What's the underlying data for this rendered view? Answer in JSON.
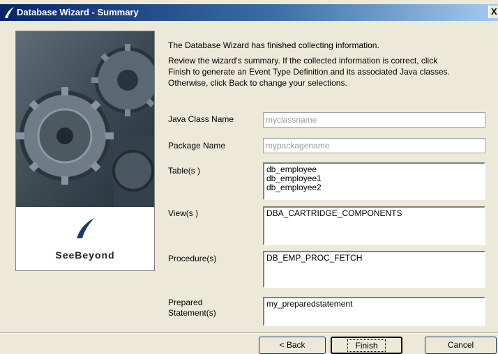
{
  "window": {
    "title": "Database Wizard - Summary",
    "close_glyph": "X"
  },
  "side_panel": {
    "brand_name": "SeeBeyond",
    "art_icon": "gears-image",
    "logo_icon": "seebeyond-swoosh-icon"
  },
  "intro": {
    "line1": "The Database Wizard has finished collecting information.",
    "line2": "Review the wizard's summary.  If the collected information is correct, click Finish to generate an Event Type Definition and its associated Java classes.  Otherwise, click Back to change your selections."
  },
  "fields": {
    "java_class": {
      "label": "Java Class Name",
      "value": "myclassname"
    },
    "package": {
      "label": "Package Name",
      "value": "mypackagename"
    },
    "tables": {
      "label": "Table(s )",
      "items": [
        "db_employee",
        "db_employee1",
        "db_employee2"
      ]
    },
    "views": {
      "label": "View(s )",
      "items": [
        "DBA_CARTRIDGE_COMPONENTS"
      ]
    },
    "procedures": {
      "label": "Procedure(s)",
      "items": [
        "DB_EMP_PROC_FETCH"
      ]
    },
    "prepared": {
      "label_line1": "Prepared",
      "label_line2": "Statement(s)",
      "items": [
        "my_preparedstatement"
      ]
    }
  },
  "buttons": {
    "back": "< Back",
    "finish": "Finish",
    "cancel": "Cancel"
  },
  "colors": {
    "titlebar_start": "#0a246a",
    "titlebar_end": "#a6caf0",
    "dialog_bg": "#ece9d8"
  }
}
